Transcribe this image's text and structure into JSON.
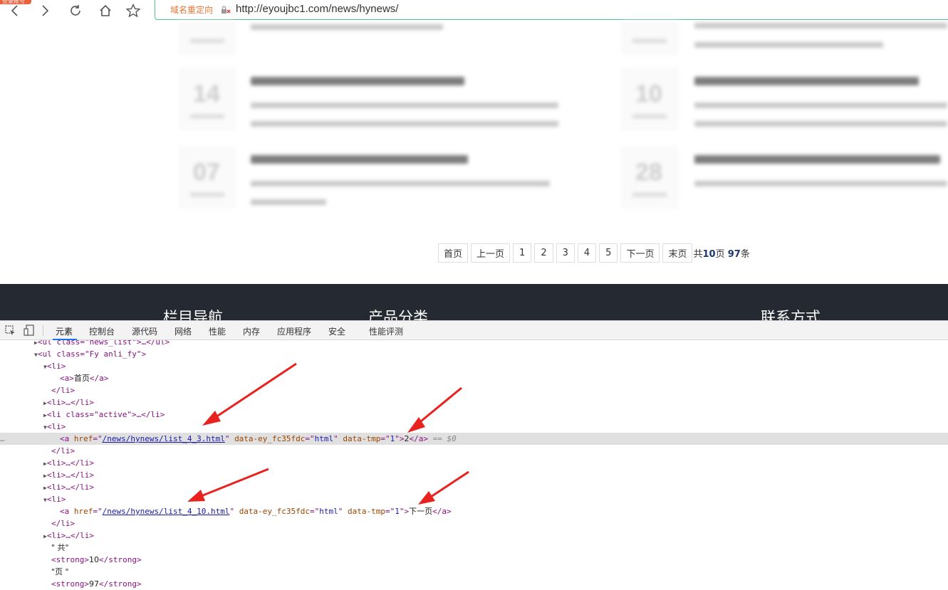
{
  "browser": {
    "account_badge": "登录账号",
    "redirect_label": "域名重定向",
    "url": "http://eyoujbc1.com/news/hynews/"
  },
  "pagination": {
    "first": "首页",
    "prev": "上一页",
    "pages": [
      "1",
      "2",
      "3",
      "4",
      "5"
    ],
    "next": "下一页",
    "last": "末页",
    "total_prefix": "共",
    "total_pages": "10",
    "total_mid": "页 ",
    "total_items": "97",
    "total_suffix": "条"
  },
  "footer": {
    "col1": "栏目导航",
    "col2": "产品分类",
    "col3": "联系方式"
  },
  "devtools": {
    "tabs": [
      "元素",
      "控制台",
      "源代码",
      "网络",
      "性能",
      "内存",
      "应用程序",
      "安全",
      "性能评测"
    ],
    "active_tab": "元素",
    "lines": {
      "l0": "<ul class=\"news_list\">…</ul>",
      "l1_open": "<ul class=\"Fy anli_fy\">",
      "li_open": "<li>",
      "li_close": "</li>",
      "a_first_text": "首页",
      "li_collapsed": "<li>…</li>",
      "li_active": "<li class=\"active\">…</li>",
      "a1_href": "/news/hynews/list_4_3.html",
      "a1_attr": "data-ey_fc35fdc",
      "a1_attr_val": "html",
      "tmp_attr": "data-tmp",
      "tmp_val": "1",
      "a1_text": "2",
      "eq0": "== $0",
      "a2_href": "/news/hynews/list_4_10.html",
      "a2_text": "下一页",
      "text_gong": "\" 共\"",
      "strong_10": "10",
      "text_ye": "\"页 \"",
      "strong_97": "97"
    }
  },
  "colors": {
    "accent_green": "#56c18e",
    "redirect_orange": "#e8773a",
    "arrow_red": "#e8231f",
    "footer_bg": "#252a32",
    "devtools_tag": "#881280"
  }
}
